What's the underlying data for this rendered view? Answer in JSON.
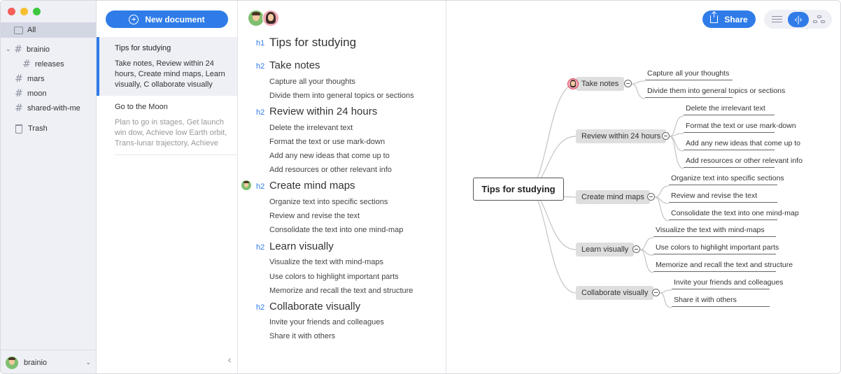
{
  "sidebar": {
    "all_label": "All",
    "tags": [
      {
        "label": "brainio",
        "expandable": true
      },
      {
        "label": "releases",
        "nested": true
      },
      {
        "label": "mars"
      },
      {
        "label": "moon"
      },
      {
        "label": "shared-with-me"
      }
    ],
    "trash_label": "Trash",
    "user_name": "brainio"
  },
  "doclist": {
    "new_document_label": "New document",
    "documents": [
      {
        "title": "Tips for studying",
        "preview": "Take notes, Review within 24 hours, Create mind maps, Learn visually, C ollaborate visually"
      },
      {
        "title": "Go to the Moon",
        "preview": "Plan to go in stages, Get launch win dow, Achieve low Earth orbit, Trans-lunar trajectory, Achieve lunar orbi…"
      }
    ]
  },
  "editor": {
    "lines": [
      {
        "level": "h1",
        "text": "Tips for studying"
      },
      {
        "level": "h2",
        "text": "Take notes"
      },
      {
        "level": "",
        "text": "Capture all your thoughts"
      },
      {
        "level": "",
        "text": "Divide them into general topics or sections"
      },
      {
        "level": "h2",
        "text": "Review within 24 hours"
      },
      {
        "level": "",
        "text": "Delete the irrelevant text"
      },
      {
        "level": "",
        "text": "Format the text or use mark-down"
      },
      {
        "level": "",
        "text": "Add any new ideas that come up to"
      },
      {
        "level": "",
        "text": "Add resources or other relevant info"
      },
      {
        "level": "h2",
        "text": "Create mind maps"
      },
      {
        "level": "",
        "text": "Organize text into specific sections"
      },
      {
        "level": "",
        "text": "Review and revise the text"
      },
      {
        "level": "",
        "text": "Consolidate the text into one mind-map"
      },
      {
        "level": "h2",
        "text": "Learn visually"
      },
      {
        "level": "",
        "text": "Visualize the text with mind-maps"
      },
      {
        "level": "",
        "text": "Use colors to highlight important parts"
      },
      {
        "level": "",
        "text": "Memorize and recall the text and structure"
      },
      {
        "level": "h2",
        "text": "Collaborate visually"
      },
      {
        "level": "",
        "text": "Invite your friends and colleagues"
      },
      {
        "level": "",
        "text": "Share it with others"
      }
    ]
  },
  "mindmap": {
    "share_label": "Share",
    "view_modes": [
      "list",
      "split",
      "mindmap"
    ],
    "active_view": "split",
    "root": "Tips for studying",
    "topics": [
      {
        "label": "Take notes",
        "children": [
          "Capture all your thoughts",
          "Divide them into general topics or sections"
        ]
      },
      {
        "label": "Review within 24 hours",
        "children": [
          "Delete the irrelevant text",
          "Format the text or use mark-down",
          "Add any new ideas that come up to",
          "Add resources or other relevant info"
        ]
      },
      {
        "label": "Create mind maps",
        "children": [
          "Organize text into specific sections",
          "Review and revise the text",
          "Consolidate the text into one mind-map"
        ]
      },
      {
        "label": "Learn visually",
        "children": [
          "Visualize the text with mind-maps",
          "Use colors to highlight important parts",
          "Memorize and recall the text and structure"
        ]
      },
      {
        "label": "Collaborate visually",
        "children": [
          "Invite your friends and colleagues",
          "Share it with others"
        ]
      }
    ]
  },
  "colors": {
    "accent": "#2f7ce8",
    "sidebar_bg": "#eef0f6",
    "topic_bg": "#dedede"
  }
}
